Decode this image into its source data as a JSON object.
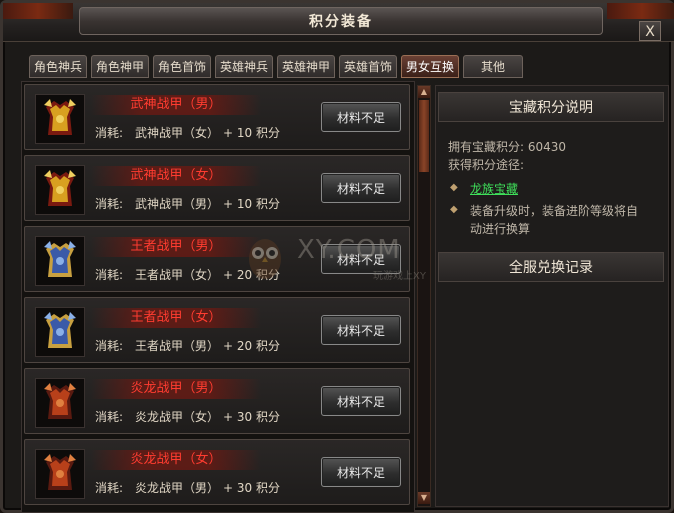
{
  "window": {
    "title": "积分装备",
    "close_label": "X"
  },
  "tabs": [
    {
      "label": "角色神兵",
      "active": false
    },
    {
      "label": "角色神甲",
      "active": false
    },
    {
      "label": "角色首饰",
      "active": false
    },
    {
      "label": "英雄神兵",
      "active": false
    },
    {
      "label": "英雄神甲",
      "active": false
    },
    {
      "label": "英雄首饰",
      "active": false
    },
    {
      "label": "男女互换",
      "active": true
    },
    {
      "label": "其他",
      "active": false
    }
  ],
  "items": [
    {
      "name": "武神战甲（男）",
      "cost_label": "消耗:",
      "cost_item": "武神战甲（女）",
      "cost_points": "+ 10 积分",
      "button": "材料不足",
      "icon": "gold-armor-icon"
    },
    {
      "name": "武神战甲（女）",
      "cost_label": "消耗:",
      "cost_item": "武神战甲（男）",
      "cost_points": "+ 10 积分",
      "button": "材料不足",
      "icon": "gold-armor-icon"
    },
    {
      "name": "王者战甲（男）",
      "cost_label": "消耗:",
      "cost_item": "王者战甲（女）",
      "cost_points": "+ 20 积分",
      "button": "材料不足",
      "icon": "blue-armor-icon"
    },
    {
      "name": "王者战甲（女）",
      "cost_label": "消耗:",
      "cost_item": "王者战甲（男）",
      "cost_points": "+ 20 积分",
      "button": "材料不足",
      "icon": "blue-armor-icon"
    },
    {
      "name": "炎龙战甲（男）",
      "cost_label": "消耗:",
      "cost_item": "炎龙战甲（女）",
      "cost_points": "+ 30 积分",
      "button": "材料不足",
      "icon": "red-armor-icon"
    },
    {
      "name": "炎龙战甲（女）",
      "cost_label": "消耗:",
      "cost_item": "炎龙战甲（男）",
      "cost_points": "+ 30 积分",
      "button": "材料不足",
      "icon": "red-armor-icon"
    }
  ],
  "info": {
    "header": "宝藏积分说明",
    "points_line": "拥有宝藏积分:  60430",
    "ways_label": "获得积分途径:",
    "way_1": "龙族宝藏",
    "way_2_line1": "装备升级时，装备进阶等级将自",
    "way_2_line2": "动进行换算",
    "records_header": "全服兑换记录"
  },
  "watermark": {
    "text": "XY.COM",
    "sub": "玩游戏上XY"
  },
  "colors": {
    "item_name": "#ff3c30",
    "link": "#3fe05a",
    "active_tab": "#6a4034"
  }
}
